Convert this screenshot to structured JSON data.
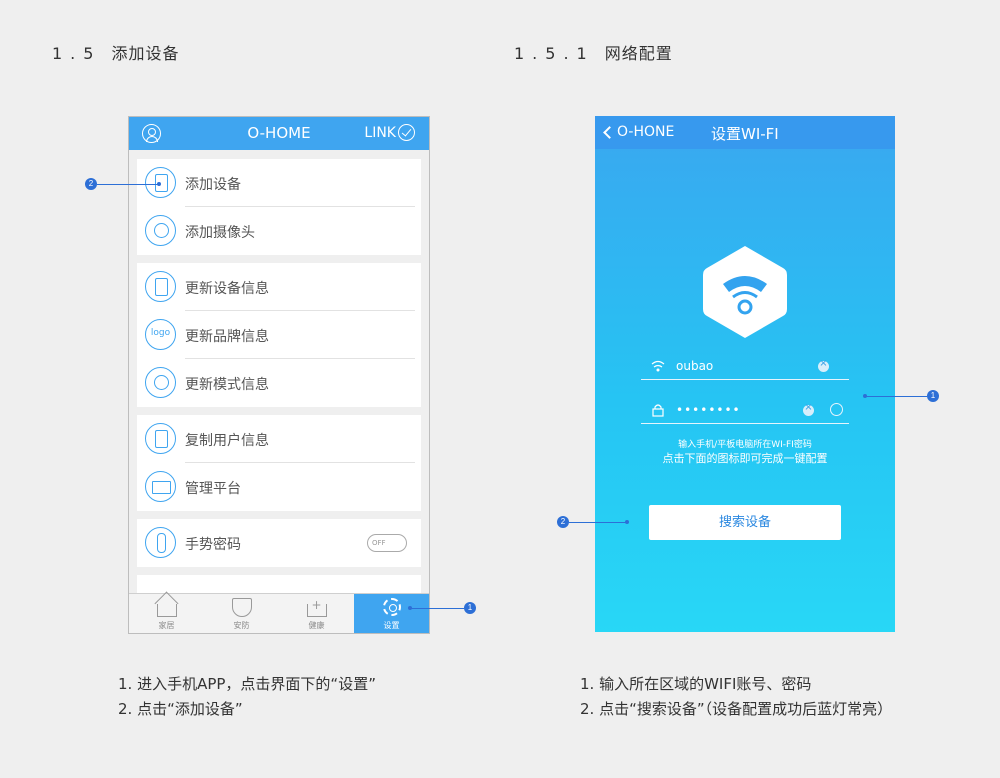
{
  "left": {
    "heading_num": "1.5",
    "heading_text": "添加设备",
    "app": {
      "title": "O-HOME",
      "link_label": "LINK",
      "groups": [
        [
          "添加设备",
          "添加摄像头"
        ],
        [
          "更新设备信息",
          "更新品牌信息",
          "更新模式信息"
        ],
        [
          "复制用户信息",
          "管理平台"
        ],
        [
          "手势密码"
        ]
      ],
      "toggle_label": "OFF",
      "tabs": [
        "家居",
        "安防",
        "健康",
        "设置"
      ],
      "active_tab": "设置"
    },
    "notes": [
      "1.  进入手机APP，点击界面下的“设置”",
      "2.  点击“添加设备”"
    ],
    "markers": [
      "1",
      "2"
    ]
  },
  "right": {
    "heading_num": "1.5.1",
    "heading_text": "网络配置",
    "app": {
      "back_label": "O-HONE",
      "title": "设置WI-FI",
      "ssid": "oubao",
      "password_mask": "••••••••",
      "hint_line1": "输入手机/平板电脑所在WI-FI密码",
      "hint_line2": "点击下面的图标即可完成一键配置",
      "search_button": "搜索设备"
    },
    "notes": [
      "1.  输入所在区域的WIFI账号、密码",
      "2.  点击“搜索设备”（设备配置成功后蓝灯常亮）"
    ],
    "markers": [
      "1",
      "2"
    ]
  },
  "colors": {
    "brand_blue": "#3fa5f0",
    "marker_blue": "#2d6fd6",
    "background": "#efefef"
  }
}
